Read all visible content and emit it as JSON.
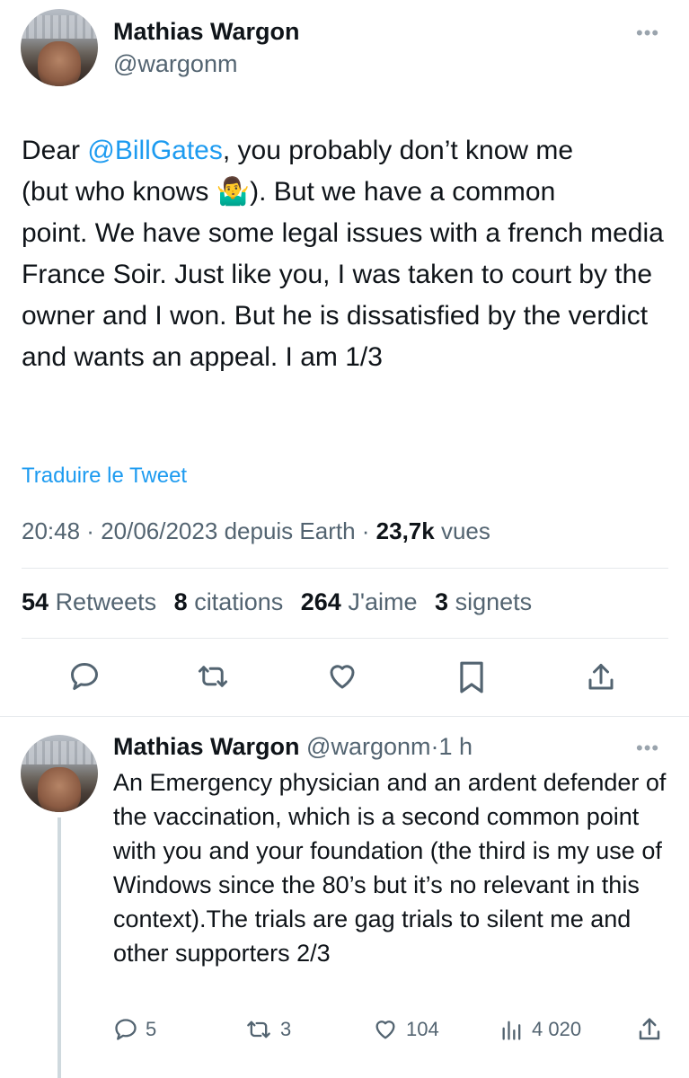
{
  "tweet": {
    "author_name": "Mathias Wargon",
    "author_handle": "@wargonm",
    "more_label": "•••",
    "text_before": "Dear ",
    "mention": "@BillGates",
    "text_line1_after": ", you probably don’t know me",
    "text_line2_a": "(but who knows ",
    "emoji": "🤷‍♂️",
    "text_line2_b": "). But we have a common",
    "text_rest": "point. We have some legal issues with a french media France Soir. Just like you, I was taken to court by the owner and I won. But he is dissatisfied by the verdict and wants an appeal. I am 1/3",
    "translate_link": "Traduire le Tweet",
    "time": "20:48",
    "date": "20/06/2023",
    "source": "depuis Earth",
    "views_count": "23,7k",
    "views_label": "vues",
    "retweets_count": "54",
    "retweets_label": "Retweets",
    "quotes_count": "8",
    "quotes_label": "citations",
    "likes_count": "264",
    "likes_label": "J'aime",
    "bookmarks_count": "3",
    "bookmarks_label": "signets"
  },
  "reply": {
    "author_name": "Mathias Wargon",
    "author_handle": "@wargonm",
    "time_ago": "1 h",
    "more_label": "•••",
    "text": "An Emergency physician and an ardent defender of the vaccination, which is a second common point with you and your foundation (the third is my use of Windows since the 80’s but it’s no relevant in this context).The trials are gag trials to silent me and other supporters 2/3",
    "replies_count": "5",
    "retweets_count": "3",
    "likes_count": "104",
    "views_count": "4 020"
  },
  "icons": {
    "reply": "comment-icon",
    "retweet": "retweet-icon",
    "like": "heart-icon",
    "bookmark": "bookmark-icon",
    "share": "share-icon",
    "views": "analytics-icon"
  },
  "colors": {
    "accent": "#1d9bf0",
    "text": "#0f1419",
    "secondary": "#536471"
  }
}
